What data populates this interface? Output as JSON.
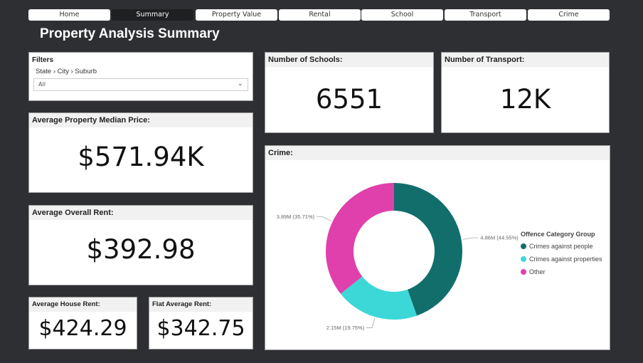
{
  "nav": {
    "tabs": [
      {
        "label": "Home",
        "active": false
      },
      {
        "label": "Summary",
        "active": true
      },
      {
        "label": "Property Value",
        "active": false
      },
      {
        "label": "Rental",
        "active": false
      },
      {
        "label": "School",
        "active": false
      },
      {
        "label": "Transport",
        "active": false
      },
      {
        "label": "Crime",
        "active": false
      }
    ]
  },
  "page": {
    "title": "Property Analysis Summary"
  },
  "filters": {
    "title": "Filters",
    "path": "State › City › Suburb",
    "selected": "All"
  },
  "cards": {
    "schools": {
      "title": "Number of Schools:",
      "value": "6551"
    },
    "transport": {
      "title": "Number of Transport:",
      "value": "12K"
    },
    "median_price": {
      "title": "Average Property Median Price:",
      "value": "$571.94K"
    },
    "overall_rent": {
      "title": "Average Overall Rent:",
      "value": "$392.98"
    },
    "house_rent": {
      "title": "Average House Rent:",
      "value": "$424.29"
    },
    "flat_rent": {
      "title": "Flat Average Rent:",
      "value": "$342.75"
    }
  },
  "crime": {
    "title": "Crime:",
    "legend_title": "Offence Category Group"
  },
  "chart_data": {
    "type": "pie",
    "donut": true,
    "legend_title": "Offence Category Group",
    "legend_position": "right",
    "categories": [
      "Crimes against people",
      "Crimes against properties",
      "Other"
    ],
    "values": [
      4.86,
      2.15,
      3.89
    ],
    "unit": "M",
    "percents": [
      44.55,
      19.75,
      35.71
    ],
    "data_labels": [
      "4.86M (44.55%)",
      "2.15M (19.75%)",
      "3.89M (35.71%)"
    ],
    "colors": [
      "#116e6b",
      "#3cd7d7",
      "#e040ab"
    ]
  },
  "icons": {
    "chevron": "chevron-down-icon"
  }
}
